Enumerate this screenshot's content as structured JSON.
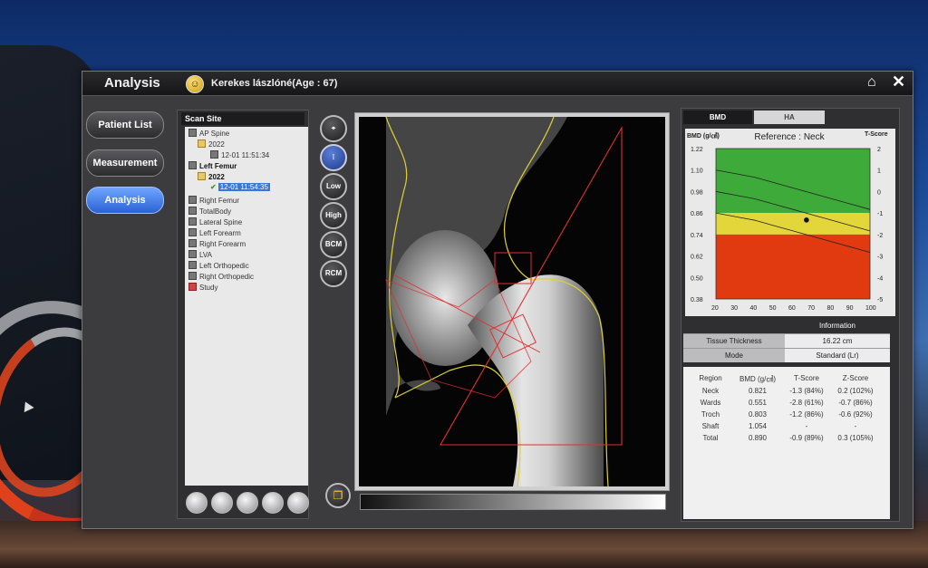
{
  "app": {
    "title": "Analysis"
  },
  "patient": {
    "name": "Kerekes lászlóné(Age : 67)"
  },
  "nav": {
    "items": [
      "Patient List",
      "Measurement",
      "Analysis"
    ],
    "active": "Analysis"
  },
  "scan_site": {
    "header": "Scan Site",
    "tree": [
      {
        "label": "AP Spine"
      },
      {
        "label": "2022"
      },
      {
        "label": "12-01 11:51:34"
      },
      {
        "label": "Left Femur"
      },
      {
        "label": "2022"
      },
      {
        "label": "12-01 11:54:35"
      },
      {
        "label": "Right Femur"
      },
      {
        "label": "TotalBody"
      },
      {
        "label": "Lateral Spine"
      },
      {
        "label": "Left Forearm"
      },
      {
        "label": "Right Forearm"
      },
      {
        "label": "LVA"
      },
      {
        "label": "Left Orthopedic"
      },
      {
        "label": "Right Orthopedic"
      },
      {
        "label": "Study"
      }
    ],
    "selected": "12-01 11:54:35"
  },
  "tools": {
    "buttons": [
      "Low",
      "High",
      "BCM",
      "RCM"
    ]
  },
  "tabs": [
    "BMD",
    "HA"
  ],
  "colors": {
    "green_zone": "#3daa3a",
    "yellow_zone": "#e3d63a",
    "red_zone": "#e23a10",
    "active_nav": "#2a62d6"
  },
  "chart_data": {
    "type": "line",
    "title": "Reference : Neck",
    "ylabel": "BMD (g/㎠)",
    "y2label": "T-Score",
    "x_ticks": [
      20,
      30,
      40,
      50,
      60,
      70,
      80,
      90,
      100
    ],
    "y_ticks": [
      "1.22",
      "1.10",
      "0.98",
      "0.86",
      "0.74",
      "0.62",
      "0.50",
      "0.38"
    ],
    "y2_ticks": [
      "2",
      "1",
      "0",
      "-1",
      "-2",
      "-3",
      "-4",
      "-5"
    ],
    "xlim": [
      20,
      100
    ],
    "ylim": [
      0.38,
      1.22
    ],
    "zones": [
      {
        "name": "normal",
        "from": 0.86,
        "to": 1.22
      },
      {
        "name": "osteopenia",
        "from": 0.74,
        "to": 0.86
      },
      {
        "name": "osteoporosis",
        "from": 0.38,
        "to": 0.74
      }
    ],
    "series": [
      {
        "x": [
          20,
          30,
          40,
          50,
          60,
          70,
          80,
          90,
          100
        ],
        "values": [
          1.1,
          1.08,
          1.06,
          1.03,
          1.0,
          0.97,
          0.94,
          0.91,
          0.88
        ]
      },
      {
        "x": [
          20,
          30,
          40,
          50,
          60,
          70,
          80,
          90,
          100
        ],
        "values": [
          0.98,
          0.96,
          0.94,
          0.91,
          0.88,
          0.85,
          0.82,
          0.79,
          0.76
        ]
      },
      {
        "x": [
          20,
          30,
          40,
          50,
          60,
          70,
          80,
          90,
          100
        ],
        "values": [
          0.86,
          0.84,
          0.82,
          0.79,
          0.76,
          0.73,
          0.7,
          0.67,
          0.64
        ]
      }
    ],
    "patient_point": {
      "age": 67,
      "bmd": 0.821
    }
  },
  "info": {
    "header": "Information",
    "rows": [
      {
        "label": "Tissue Thickness",
        "value": "16.22 cm"
      },
      {
        "label": "Mode",
        "value": "Standard (Lr)"
      }
    ]
  },
  "results": {
    "headers": [
      "Region",
      "BMD (g/㎠)",
      "T-Score",
      "Z-Score"
    ],
    "rows": [
      [
        "Neck",
        "0.821",
        "-1.3 (84%)",
        "0.2 (102%)"
      ],
      [
        "Wards",
        "0.551",
        "-2.8 (61%)",
        "-0.7 (86%)"
      ],
      [
        "Troch",
        "0.803",
        "-1.2 (86%)",
        "-0.6 (92%)"
      ],
      [
        "Shaft",
        "1.054",
        "-",
        "-"
      ],
      [
        "Total",
        "0.890",
        "-0.9 (89%)",
        "0.3 (105%)"
      ]
    ]
  }
}
